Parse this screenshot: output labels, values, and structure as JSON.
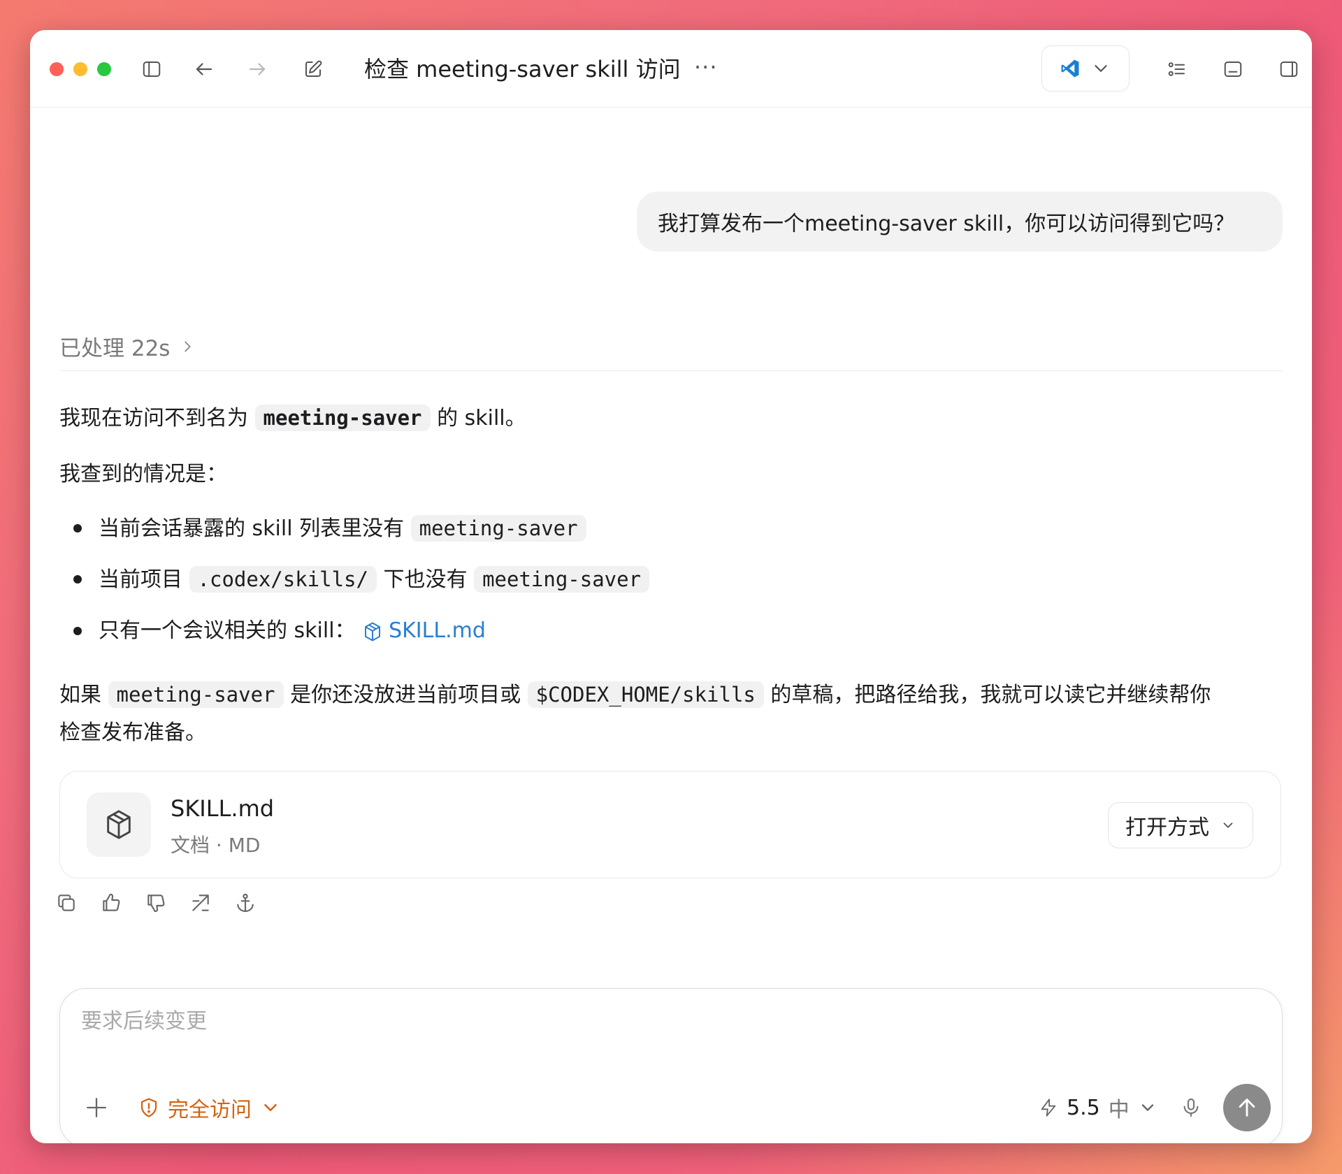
{
  "window": {
    "title": "检查 meeting-saver skill 访问",
    "more_label": "···"
  },
  "conversation": {
    "user_message": "我打算发布一个meeting-saver skill，你可以访问得到它吗？",
    "processed_label": "已处理 22s",
    "response": {
      "line1_before": "我现在访问不到名为 ",
      "line1_code": "meeting-saver",
      "line1_after": " 的 skill。",
      "line2": "我查到的情况是：",
      "bullets": [
        {
          "before": "当前会话暴露的 skill 列表里没有 ",
          "code": "meeting-saver"
        },
        {
          "before": "当前项目 ",
          "code": ".codex/skills/",
          "middle": " 下也没有 ",
          "code2": "meeting-saver"
        },
        {
          "before": "只有一个会议相关的 skill：",
          "link": "SKILL.md"
        }
      ],
      "para_before": "如果 ",
      "para_code1": "meeting-saver",
      "para_mid": " 是你还没放进当前项目或 ",
      "para_code2": "$CODEX_HOME/skills",
      "para_after": " 的草稿，把路径给我，我就可以读它并继续帮你",
      "para_line2": "检查发布准备。"
    },
    "file_card": {
      "name": "SKILL.md",
      "type": "文档 · MD",
      "open_with_label": "打开方式"
    }
  },
  "composer": {
    "placeholder": "要求后续变更",
    "access_label": "完全访问",
    "model_version": "5.5",
    "model_level": "中"
  },
  "colors": {
    "accent_link": "#2a7ed2",
    "access_warning": "#d4620e",
    "send_button": "#8a8a8a",
    "vscode_blue": "#1a7fd4"
  },
  "icons": {
    "titlebar": [
      "sidebar-toggle-icon",
      "back-arrow-icon",
      "forward-arrow-icon",
      "compose-icon",
      "vscode-icon",
      "chevron-down-icon",
      "list-icon",
      "terminal-panel-icon",
      "right-panel-icon"
    ],
    "actions": [
      "copy-icon",
      "thumbs-up-icon",
      "thumbs-down-icon",
      "share-icon",
      "anchor-icon"
    ]
  }
}
